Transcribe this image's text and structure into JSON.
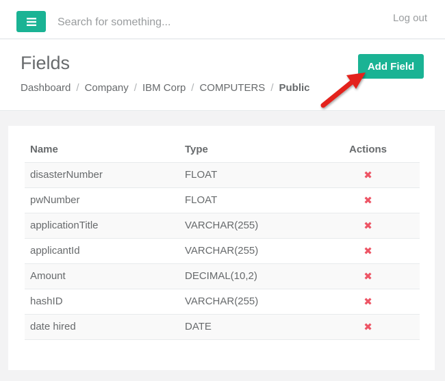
{
  "topbar": {
    "menu_icon": "hamburger-icon",
    "search_placeholder": "Search for something...",
    "logout_label": "Log out"
  },
  "page": {
    "title": "Fields",
    "add_button_label": "Add Field",
    "breadcrumb": [
      "Dashboard",
      "Company",
      "IBM Corp",
      "COMPUTERS",
      "Public"
    ]
  },
  "table": {
    "headers": {
      "name": "Name",
      "type": "Type",
      "actions": "Actions"
    },
    "rows": [
      {
        "name": "disasterNumber",
        "type": "FLOAT"
      },
      {
        "name": "pwNumber",
        "type": "FLOAT"
      },
      {
        "name": "applicationTitle",
        "type": "VARCHAR(255)"
      },
      {
        "name": "applicantId",
        "type": "VARCHAR(255)"
      },
      {
        "name": "Amount",
        "type": "DECIMAL(10,2)"
      },
      {
        "name": "hashID",
        "type": "VARCHAR(255)"
      },
      {
        "name": "date hired",
        "type": "DATE"
      }
    ],
    "delete_icon": "✖"
  },
  "colors": {
    "accent": "#1ab394",
    "danger": "#ed5565",
    "arrow": "#e3211b"
  }
}
